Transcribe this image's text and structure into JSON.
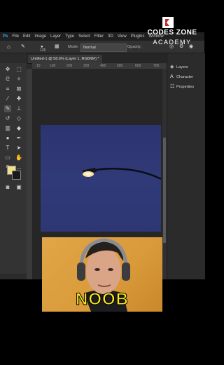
{
  "menu": {
    "app_badge": "Ps",
    "items": [
      "File",
      "Edit",
      "Image",
      "Layer",
      "Type",
      "Select",
      "Filter",
      "3D",
      "View",
      "Plugins",
      "Window"
    ]
  },
  "options": {
    "brush_size": "125",
    "mode_label": "Mode:",
    "mode_value": "Normal",
    "opacity_label": "Opacity:"
  },
  "document": {
    "tab_title": "Untitled-1 @ 58.6% (Layer 1, RGB/8#) *",
    "ruler_ticks": [
      "10",
      "100",
      "200",
      "300",
      "400",
      "500",
      "600",
      "700"
    ]
  },
  "panels": {
    "items": [
      {
        "label": "Layers",
        "icon": "layers-icon"
      },
      {
        "label": "Character",
        "icon": "character-icon"
      },
      {
        "label": "Properties",
        "icon": "properties-icon"
      }
    ]
  },
  "logo": {
    "line1": "CODES ZONE",
    "line2": "ACADEMY"
  },
  "overlay": {
    "caption": "NOOB"
  },
  "colors": {
    "foreground": "#f0e08a",
    "background": "#1a1a1a",
    "caption": "#f7e71b"
  }
}
